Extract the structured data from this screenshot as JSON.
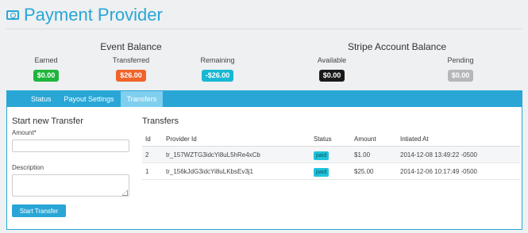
{
  "header": {
    "title": "Payment Provider",
    "icon": "money-icon"
  },
  "event_balance": {
    "title": "Event Balance",
    "earned": {
      "label": "Earned",
      "value": "$0.00",
      "color": "#1fb53c"
    },
    "transferred": {
      "label": "Transferred",
      "value": "$26.00",
      "color": "#f0632a"
    },
    "remaining": {
      "label": "Remaining",
      "value": "-$26.00",
      "color": "#17b8d4"
    }
  },
  "stripe_balance": {
    "title": "Stripe Account Balance",
    "available": {
      "label": "Available",
      "value": "$0.00",
      "color": "#1a1a1a"
    },
    "pending": {
      "label": "Pending",
      "value": "$0.00",
      "color": "#b5b7b8"
    }
  },
  "tabs": [
    {
      "label": "Status",
      "active": false
    },
    {
      "label": "Payout Settings",
      "active": false
    },
    {
      "label": "Transfers",
      "active": true
    }
  ],
  "form": {
    "title": "Start new Transfer",
    "amount_label": "Amount*",
    "amount_value": "",
    "description_label": "Description",
    "description_value": "",
    "submit_label": "Start Transfer"
  },
  "transfers": {
    "title": "Transfers",
    "columns": [
      "Id",
      "Provider Id",
      "Status",
      "Amount",
      "Intiated At"
    ],
    "rows": [
      {
        "id": "2",
        "provider_id": "tr_157WZTG3idcYi8uL5hRe4xCb",
        "status": "paid",
        "amount": "$1.00",
        "initiated_at": "2014-12-08 13:49:22 -0500"
      },
      {
        "id": "1",
        "provider_id": "tr_156kJdG3idcYi8uLKbsEv3j1",
        "status": "paid",
        "amount": "$25.00",
        "initiated_at": "2014-12-06 10:17:49 -0500"
      }
    ]
  },
  "accent_color": "#29a6d6"
}
